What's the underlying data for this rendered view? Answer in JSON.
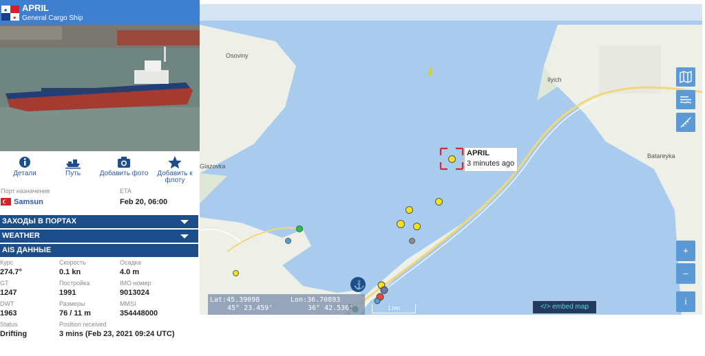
{
  "ship": {
    "name": "APRIL",
    "type": "General Cargo Ship",
    "flag_colors": [
      "#d42128",
      "#1a3e8f",
      "#ffffff"
    ]
  },
  "actions": [
    {
      "label": "Детали",
      "icon": "info-icon"
    },
    {
      "label": "Путь",
      "icon": "ship-track-icon"
    },
    {
      "label": "Добавить фото",
      "icon": "camera-icon"
    },
    {
      "label": "Добавить к флоту",
      "icon": "star-icon"
    }
  ],
  "destination": {
    "port_label": "Порт назначения",
    "port": "Samsun",
    "eta_label": "ETA",
    "eta": "Feb 20, 06:00"
  },
  "sections": {
    "port_calls": "ЗАХОДЫ В ПОРТАХ",
    "weather": "WEATHER",
    "ais": "AIS ДАННЫЕ"
  },
  "ais": {
    "course_label": "Курс",
    "course": "274.7°",
    "speed_label": "Скорость",
    "speed": "0.1 kn",
    "draught_label": "Осадка",
    "draught": "4.0 m",
    "gt_label": "GT",
    "gt": "1247",
    "built_label": "Постройка",
    "built": "1991",
    "imo_label": "IMO номер",
    "imo": "9013024",
    "dwt_label": "DWT",
    "dwt": "1963",
    "size_label": "Размеры",
    "size": "76 / 11 m",
    "mmsi_label": "MMSI",
    "mmsi": "354448000",
    "status_label": "Status",
    "status": "Drifting",
    "received_label": "Position received",
    "received": "3 mins (Feb 23, 2021 09:24 UTC)"
  },
  "map": {
    "places": {
      "osoviny": "Osoviny",
      "glazovka": "Glazovka",
      "ilyich": "Ilyich",
      "batareyka": "Batareyka"
    },
    "popup": {
      "name": "APRIL",
      "age": "3 minutes ago"
    },
    "coords": {
      "lat": "Lat:45.39098",
      "lon": "Lon:36.70893",
      "lat_dms": "45° 23.459'",
      "lon_dms": "36° 42.536'"
    },
    "scale": "1 nm",
    "embed": "</> embed map",
    "zoom_in": "+",
    "zoom_out": "–",
    "info": "i",
    "colors": {
      "water": "#a9ccee",
      "land": "#eef0e8",
      "vessel": "#f2e21f"
    }
  }
}
